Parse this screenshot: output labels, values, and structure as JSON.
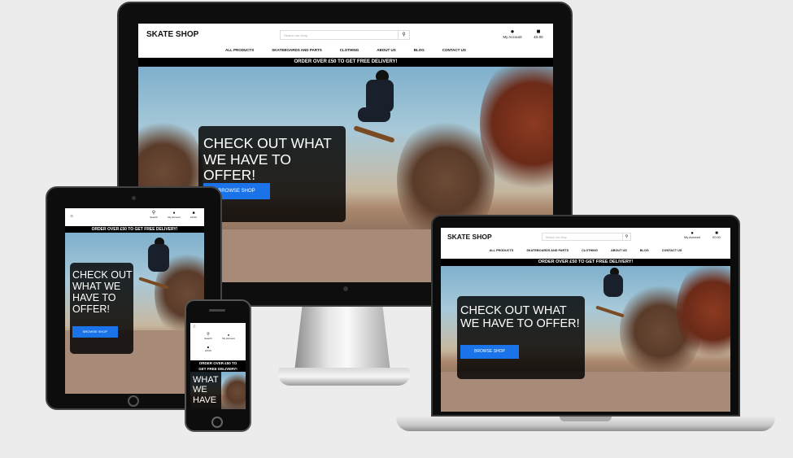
{
  "site": {
    "logo": "SKATE SHOP",
    "search_placeholder": "Search our shop",
    "account_label": "My Account",
    "bag_total": "£0.00",
    "search_label": "Search",
    "nav": [
      "ALL PRODUCTS",
      "SKATEBOARDS AND PARTS",
      "CLOTHING",
      "ABOUT US",
      "BLOG",
      "CONTACT US"
    ],
    "banner": "ORDER OVER £50 TO GET FREE DELIVERY!",
    "hero_title": "CHECK OUT WHAT WE HAVE TO OFFER!",
    "hero_button": "BROWSE SHOP",
    "phone_hero_fragment": "WHAT WE HAVE",
    "phone_banner_line1": "ORDER OVER £50 TO",
    "phone_banner_line2": "GET FREE DELIVERY!"
  },
  "icons": {
    "account": "person-icon",
    "bag": "shopping-bag-icon",
    "search": "magnifier-icon",
    "menu": "hamburger-icon"
  },
  "colors": {
    "accent": "#1a73e8",
    "banner_bg": "#000000",
    "cta_bg": "rgba(0,0,0,0.82)"
  }
}
